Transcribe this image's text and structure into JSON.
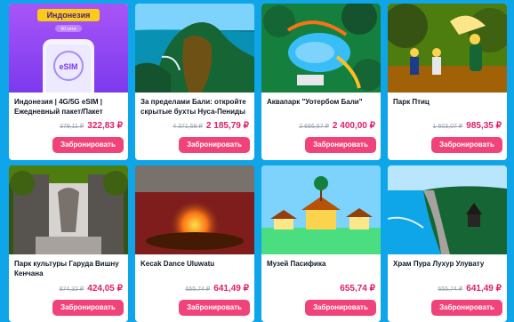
{
  "button_label": "Забронировать",
  "accent": "#f0437a",
  "background": "#0ea5e9",
  "cards": [
    {
      "title": "Индонезия | 4G/5G eSIM | Ежедневный пакет/Пакет данн...",
      "old_price": "379,11 ₽",
      "price": "322,83 ₽",
      "thumb": {
        "heading": "Индонезия",
        "badge": "90 сети",
        "label": "eSIM"
      }
    },
    {
      "title": "За пределами Бали: откройте скрытые бухты Нуса-Пениды и...",
      "old_price": "4 371,59 ₽",
      "price": "2 185,79 ₽"
    },
    {
      "title": "Аквапарк \"Уотербом Бали\"",
      "old_price": "2 666,67 ₽",
      "price": "2 400,00 ₽"
    },
    {
      "title": "Парк Птиц",
      "old_price": "1 603,07 ₽",
      "price": "985,35 ₽"
    },
    {
      "title": "Парк культуры Гаруда Вишну Кенчана",
      "old_price": "874,32 ₽",
      "price": "424,05 ₽"
    },
    {
      "title": "Kecak Dance Uluwatu",
      "old_price": "655,74 ₽",
      "price": "641,49 ₽"
    },
    {
      "title": "Музей Пасифика",
      "old_price": "",
      "price": "655,74 ₽"
    },
    {
      "title": "Храм Пура Лухур Улувату",
      "old_price": "655,74 ₽",
      "price": "641,49 ₽"
    }
  ]
}
